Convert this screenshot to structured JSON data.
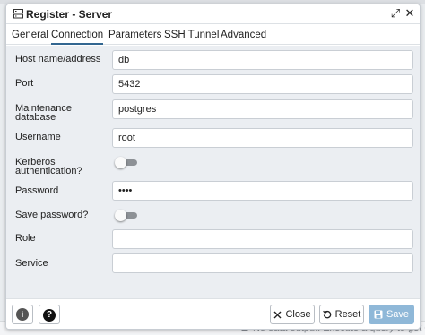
{
  "dialog": {
    "title": "Register - Server",
    "expand_glyph": "⤢",
    "close_glyph": "✕"
  },
  "tabs": [
    {
      "label": "General"
    },
    {
      "label": "Connection",
      "active": true
    },
    {
      "label": "Parameters"
    },
    {
      "label": "SSH Tunnel"
    },
    {
      "label": "Advanced"
    }
  ],
  "form": {
    "host": {
      "label": "Host name/address",
      "value": "db"
    },
    "port": {
      "label": "Port",
      "value": "5432"
    },
    "maintenance_db": {
      "label_line1": "Maintenance",
      "label_line2": "database",
      "value": "postgres"
    },
    "username": {
      "label": "Username",
      "value": "root"
    },
    "kerberos": {
      "label_line1": "Kerberos",
      "label_line2": "authentication?",
      "enabled": false
    },
    "password": {
      "label": "Password",
      "value": "••••"
    },
    "save_password": {
      "label": "Save password?",
      "enabled": false
    },
    "role": {
      "label": "Role",
      "value": ""
    },
    "service": {
      "label": "Service",
      "value": ""
    }
  },
  "footer": {
    "info_glyph": "i",
    "help_glyph": "?",
    "close_label": "Close",
    "reset_label": "Reset",
    "save_label": "Save"
  },
  "background": {
    "status_text": "No data output. Execute a query to get output."
  },
  "colors": {
    "accent": "#326690",
    "save_button": "#8fb8d8",
    "toggle_off": "#8d9196"
  }
}
